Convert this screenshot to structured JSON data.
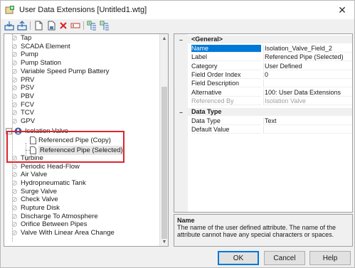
{
  "window": {
    "title": "User Data Extensions [Untitled1.wtg]",
    "close_glyph": "✕"
  },
  "toolbar": {
    "icons": [
      "import-icon",
      "export-icon",
      "new-icon",
      "save-icon",
      "delete-icon",
      "rename-icon",
      "expand-all-icon",
      "collapse-all-icon"
    ]
  },
  "tree": {
    "items_above": [
      "Tap",
      "SCADA Element",
      "Pump",
      "Pump Station",
      "Variable Speed Pump Battery",
      "PRV",
      "PSV",
      "PBV",
      "FCV",
      "TCV",
      "GPV"
    ],
    "expanded_node": {
      "label": "Isolation Valve",
      "children": [
        "Referenced Pipe (Copy)",
        "Referenced Pipe (Selected)"
      ]
    },
    "items_below": [
      "Turbine",
      "Periodic Head-Flow",
      "Air Valve",
      "Hydropneumatic Tank",
      "Surge Valve",
      "Check Valve",
      "Rupture Disk",
      "Discharge To Atmosphere",
      "Orifice Between Pipes",
      "Valve With Linear Area Change"
    ]
  },
  "properties": {
    "general_header": "<General>",
    "general_rows": [
      {
        "name": "Name",
        "value": "Isolation_Valve_Field_2"
      },
      {
        "name": "Label",
        "value": "Referenced Pipe (Selected)"
      },
      {
        "name": "Category",
        "value": "User Defined"
      },
      {
        "name": "Field Order Index",
        "value": "0"
      },
      {
        "name": "Field Description",
        "value": ""
      },
      {
        "name": "Alternative",
        "value": "100:  User Data Extensions"
      },
      {
        "name": "Referenced By",
        "value": "Isolation Valve"
      }
    ],
    "datatype_header": "Data Type",
    "datatype_rows": [
      {
        "name": "Data Type",
        "value": "Text"
      },
      {
        "name": "Default Value",
        "value": ""
      }
    ]
  },
  "description": {
    "title": "Name",
    "text": "The name of the user defined attribute.  The name of the attribute cannot have any special characters or spaces."
  },
  "buttons": {
    "ok": "OK",
    "cancel": "Cancel",
    "help": "Help"
  },
  "colors": {
    "selection": "#0078d7",
    "highlight_box": "#d9272e"
  }
}
